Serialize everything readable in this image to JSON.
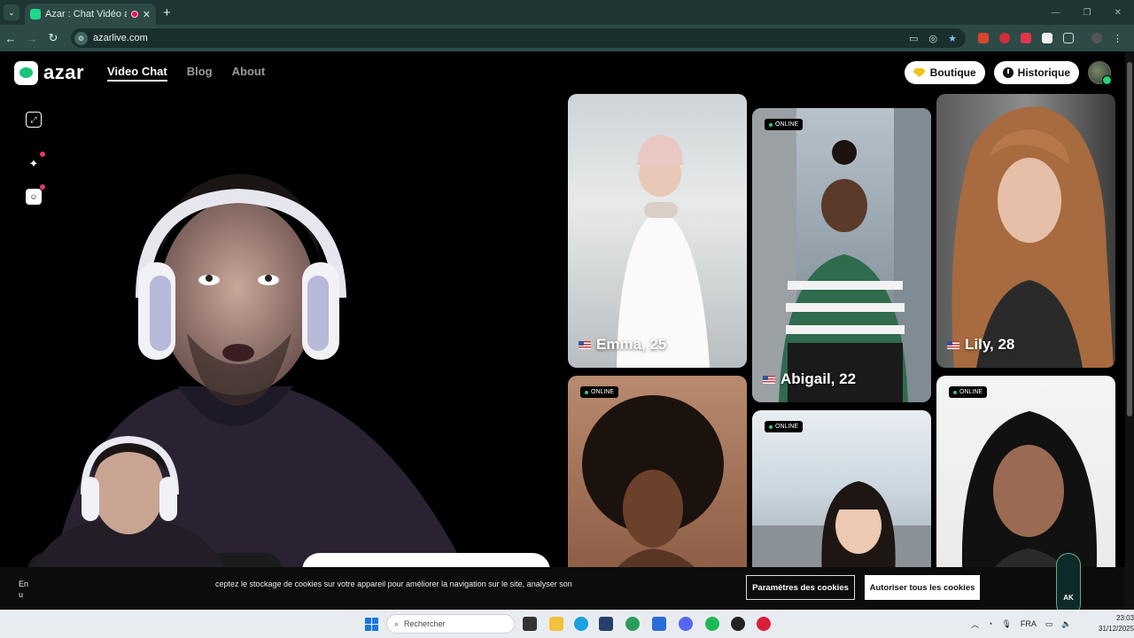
{
  "browser": {
    "tab_title": "Azar : Chat Vidéo avec de n",
    "tab_close": "✕",
    "new_tab": "+",
    "url": "azarlive.com"
  },
  "site": {
    "logo_text": "azar",
    "nav": [
      "Video Chat",
      "Blog",
      "About"
    ],
    "shop_label": "Boutique",
    "history_label": "Historique"
  },
  "cards": [
    {
      "name": "Emma, 25"
    },
    {
      "name": "Abigail, 22",
      "badge": "ONLINE"
    },
    {
      "name": "Lily, 28"
    },
    {
      "badge": "ONLINE"
    },
    {
      "badge": "ONLINE"
    },
    {
      "badge": "ONLINE"
    }
  ],
  "cookie": {
    "text_left": "En",
    "text_left2": "u",
    "text_main": "ceptez le stockage de cookies sur votre appareil pour améliorer la navigation sur le site, analyser son",
    "settings_btn": "Paramètres des cookies",
    "accept_btn": "Autoriser tous les cookies"
  },
  "overlay_badge": "AK",
  "taskbar": {
    "search_placeholder": "Rechercher",
    "lang": "FRA",
    "time": "23:03",
    "date": "31/12/2025"
  },
  "colors": {
    "brand": "#19c47a",
    "chrome": "#2d4a47",
    "online": "#2ad17a"
  }
}
